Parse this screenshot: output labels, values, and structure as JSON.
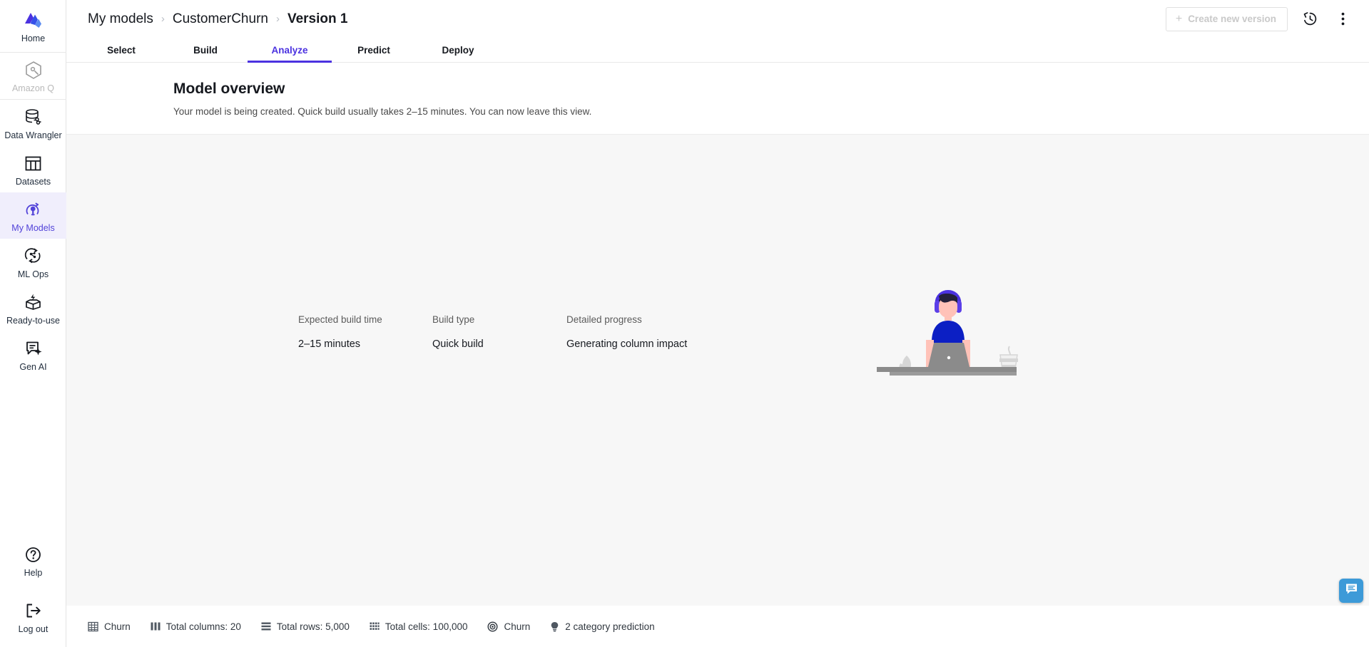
{
  "sidebar": {
    "items": [
      {
        "label": "Home",
        "icon": "home-logo-icon",
        "state": "normal"
      },
      {
        "label": "Amazon Q",
        "icon": "amazon-q-icon",
        "state": "disabled"
      },
      {
        "label": "Data Wrangler",
        "icon": "data-wrangler-icon",
        "state": "normal"
      },
      {
        "label": "Datasets",
        "icon": "datasets-icon",
        "state": "normal"
      },
      {
        "label": "My Models",
        "icon": "my-models-icon",
        "state": "active"
      },
      {
        "label": "ML Ops",
        "icon": "ml-ops-icon",
        "state": "normal"
      },
      {
        "label": "Ready-to-use",
        "icon": "ready-to-use-icon",
        "state": "normal"
      },
      {
        "label": "Gen AI",
        "icon": "gen-ai-icon",
        "state": "normal"
      }
    ],
    "bottom_items": [
      {
        "label": "Help",
        "icon": "help-circle-icon"
      },
      {
        "label": "Log out",
        "icon": "logout-arrow-icon"
      }
    ]
  },
  "header": {
    "breadcrumb": [
      {
        "label": "My models",
        "current": false
      },
      {
        "label": "CustomerChurn",
        "current": false
      },
      {
        "label": "Version 1",
        "current": true
      }
    ],
    "separator": "›",
    "create_version_label": "Create new version",
    "create_version_plus": "+",
    "history_icon": "version-history-icon",
    "more_icon": "more-options-kebab-icon"
  },
  "tabs": [
    {
      "label": "Select",
      "active": false
    },
    {
      "label": "Build",
      "active": false
    },
    {
      "label": "Analyze",
      "active": true
    },
    {
      "label": "Predict",
      "active": false
    },
    {
      "label": "Deploy",
      "active": false
    }
  ],
  "page": {
    "title": "Model overview",
    "subtitle": "Your model is being created. Quick build usually takes 2–15 minutes. You can now leave this view."
  },
  "build_info": [
    {
      "label": "Expected build time",
      "value": "2–15 minutes"
    },
    {
      "label": "Build type",
      "value": "Quick build"
    },
    {
      "label": "Detailed progress",
      "value": "Generating column impact"
    }
  ],
  "status_bar": [
    {
      "icon": "dataset-table-icon",
      "text": "Churn"
    },
    {
      "icon": "columns-icon",
      "text": "Total columns: 20"
    },
    {
      "icon": "rows-icon",
      "text": "Total rows: 5,000"
    },
    {
      "icon": "cells-grid-icon",
      "text": "Total cells: 100,000"
    },
    {
      "icon": "target-icon",
      "text": "Churn"
    },
    {
      "icon": "lightbulb-icon",
      "text": "2 category prediction"
    }
  ],
  "chat": {
    "icon": "chat-bubble-icon"
  },
  "colors": {
    "accent_purple": "#4b32e0",
    "sidebar_active_bg": "#f0eefc",
    "content_bg": "#f7f7f7",
    "chat_blue": "#3d9ad8",
    "shirt_blue": "#0c1fc4",
    "skin": "#ffc2b8",
    "hair": "#23203a"
  }
}
